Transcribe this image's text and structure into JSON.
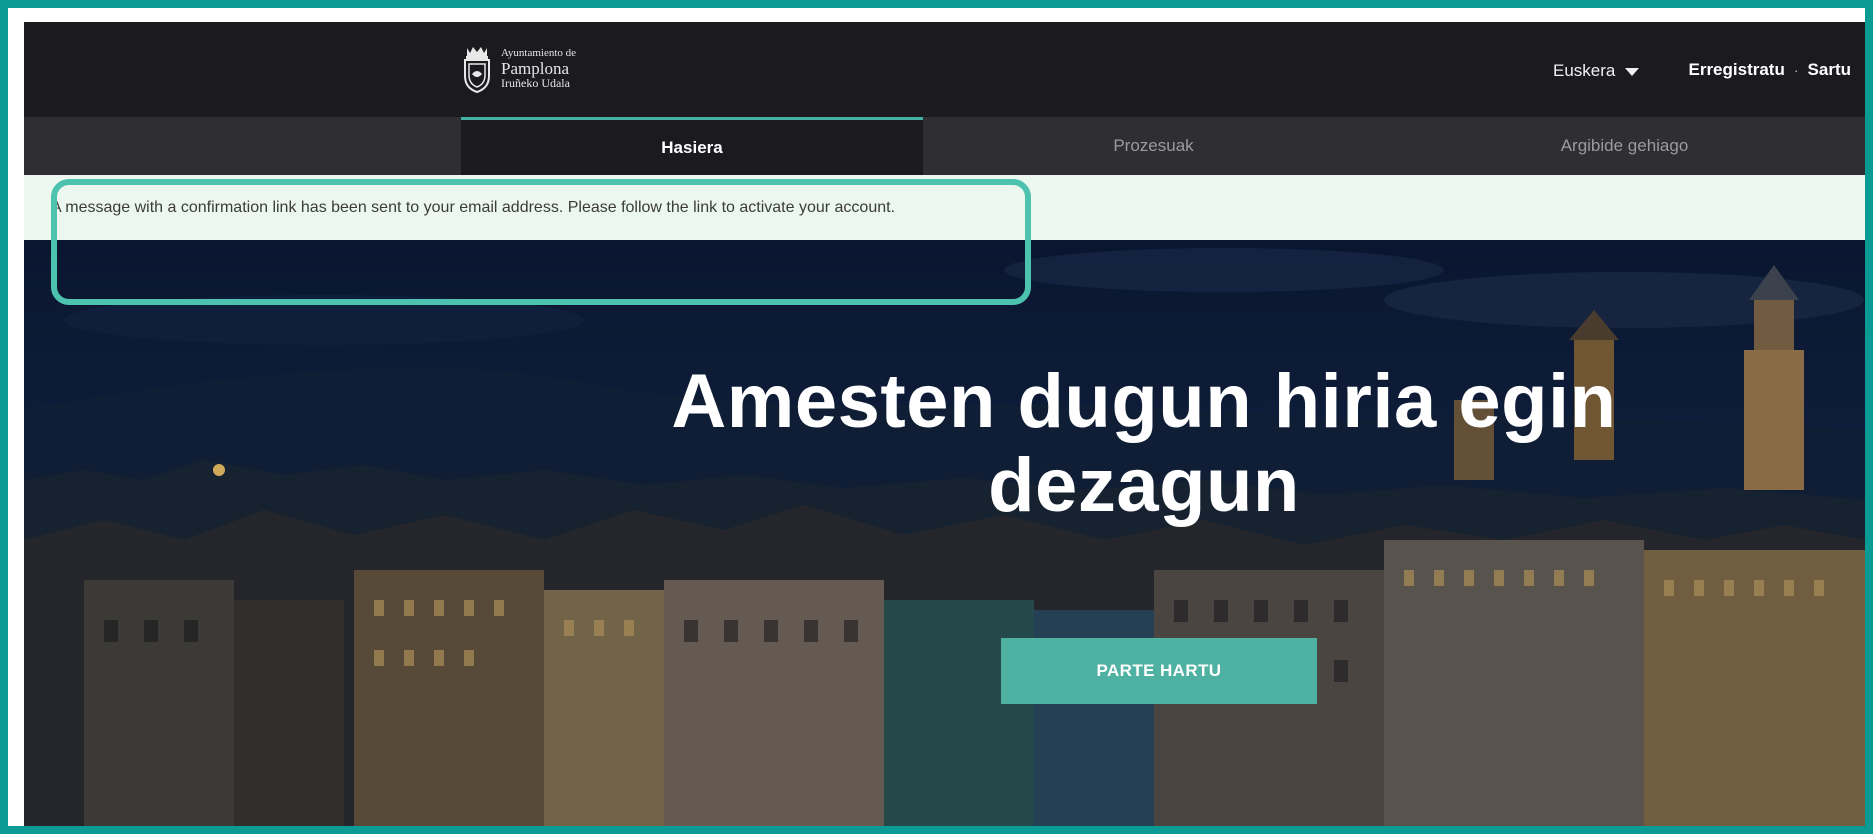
{
  "header": {
    "logo": {
      "line1": "Ayuntamiento de",
      "line2": "Pamplona",
      "line3": "Iruñeko Udala"
    },
    "language": "Euskera",
    "register_label": "Erregistratu",
    "separator": "·",
    "login_label": "Sartu"
  },
  "nav": {
    "tabs": [
      {
        "label": "Hasiera",
        "active": true
      },
      {
        "label": "Prozesuak",
        "active": false
      },
      {
        "label": "Argibide gehiago",
        "active": false
      }
    ]
  },
  "flash": {
    "message": "A message with a confirmation link has been sent to your email address. Please follow the link to activate your account."
  },
  "hero": {
    "title_line1": "Amesten dugun hiria egin",
    "title_line2": "dezagun",
    "cta_label": "PARTE HARTU"
  },
  "colors": {
    "frame": "#0a9b94",
    "accent": "#4fb1a2",
    "highlight": "#4dc3af",
    "header_bg": "#1b1a1f",
    "nav_bg": "#2f2e33",
    "flash_bg": "#ecf8ef"
  },
  "icons": {
    "logo": "city-crest-icon",
    "language_dropdown": "caret-down-icon"
  }
}
